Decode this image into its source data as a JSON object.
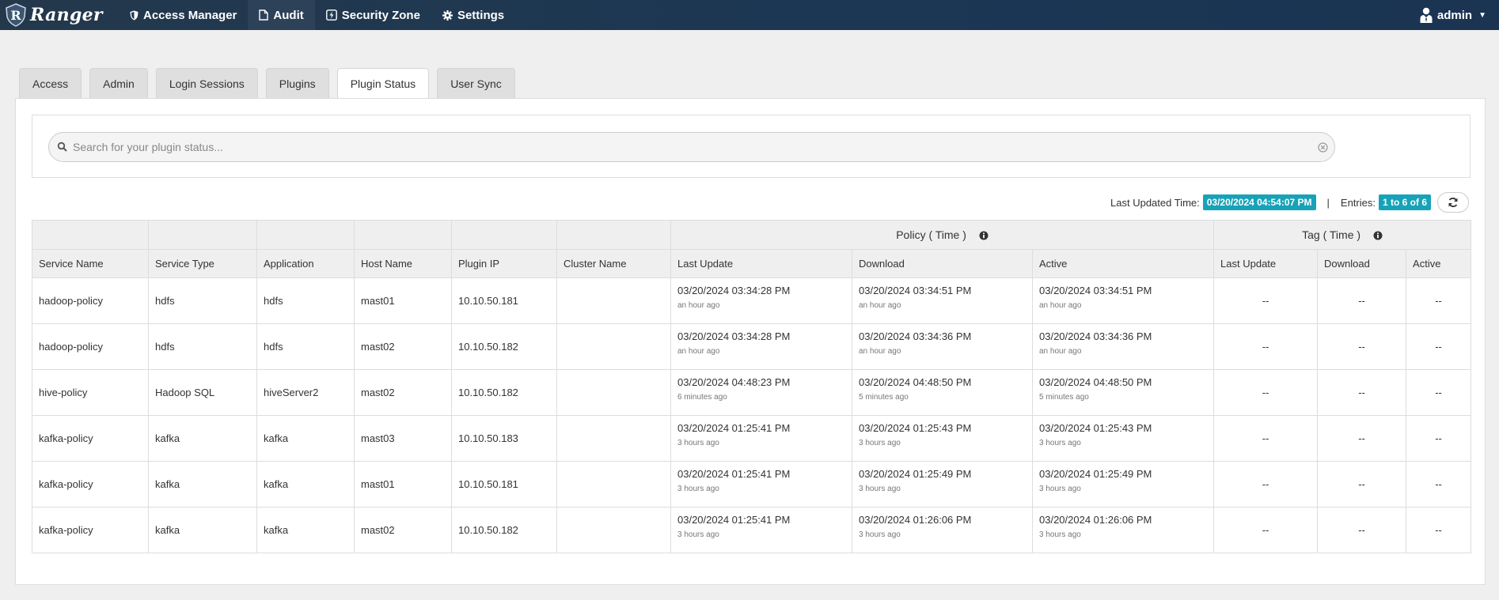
{
  "navbar": {
    "brand": "Ranger",
    "items": [
      {
        "label": "Access Manager",
        "icon": "shield-icon"
      },
      {
        "label": "Audit",
        "icon": "file-icon"
      },
      {
        "label": "Security Zone",
        "icon": "bolt-square-icon"
      },
      {
        "label": "Settings",
        "icon": "gear-icon"
      }
    ],
    "active": "Audit",
    "user": "admin"
  },
  "tabs": [
    "Access",
    "Admin",
    "Login Sessions",
    "Plugins",
    "Plugin Status",
    "User Sync"
  ],
  "active_tab": "Plugin Status",
  "search": {
    "placeholder": "Search for your plugin status..."
  },
  "status": {
    "last_updated_label": "Last Updated Time:",
    "last_updated_value": "03/20/2024 04:54:07 PM",
    "separator": "|",
    "entries_label": "Entries:",
    "entries_value": "1 to 6 of 6"
  },
  "table": {
    "groups": {
      "policy": "Policy ( Time )",
      "tag": "Tag ( Time )"
    },
    "columns": [
      "Service Name",
      "Service Type",
      "Application",
      "Host Name",
      "Plugin IP",
      "Cluster Name",
      "Last Update",
      "Download",
      "Active",
      "Last Update",
      "Download",
      "Active"
    ],
    "rows": [
      {
        "service": "hadoop-policy",
        "type": "hdfs",
        "app": "hdfs",
        "host": "mast01",
        "ip": "10.10.50.181",
        "cluster": "",
        "p_last": "03/20/2024 03:34:28 PM",
        "p_last_ago": "an hour ago",
        "p_dl": "03/20/2024 03:34:51 PM",
        "p_dl_ago": "an hour ago",
        "p_act": "03/20/2024 03:34:51 PM",
        "p_act_ago": "an hour ago",
        "t_last": "--",
        "t_dl": "--",
        "t_act": "--"
      },
      {
        "service": "hadoop-policy",
        "type": "hdfs",
        "app": "hdfs",
        "host": "mast02",
        "ip": "10.10.50.182",
        "cluster": "",
        "p_last": "03/20/2024 03:34:28 PM",
        "p_last_ago": "an hour ago",
        "p_dl": "03/20/2024 03:34:36 PM",
        "p_dl_ago": "an hour ago",
        "p_act": "03/20/2024 03:34:36 PM",
        "p_act_ago": "an hour ago",
        "t_last": "--",
        "t_dl": "--",
        "t_act": "--"
      },
      {
        "service": "hive-policy",
        "type": "Hadoop SQL",
        "app": "hiveServer2",
        "host": "mast02",
        "ip": "10.10.50.182",
        "cluster": "",
        "p_last": "03/20/2024 04:48:23 PM",
        "p_last_ago": "6 minutes ago",
        "p_dl": "03/20/2024 04:48:50 PM",
        "p_dl_ago": "5 minutes ago",
        "p_act": "03/20/2024 04:48:50 PM",
        "p_act_ago": "5 minutes ago",
        "t_last": "--",
        "t_dl": "--",
        "t_act": "--"
      },
      {
        "service": "kafka-policy",
        "type": "kafka",
        "app": "kafka",
        "host": "mast03",
        "ip": "10.10.50.183",
        "cluster": "",
        "p_last": "03/20/2024 01:25:41 PM",
        "p_last_ago": "3 hours ago",
        "p_dl": "03/20/2024 01:25:43 PM",
        "p_dl_ago": "3 hours ago",
        "p_act": "03/20/2024 01:25:43 PM",
        "p_act_ago": "3 hours ago",
        "t_last": "--",
        "t_dl": "--",
        "t_act": "--"
      },
      {
        "service": "kafka-policy",
        "type": "kafka",
        "app": "kafka",
        "host": "mast01",
        "ip": "10.10.50.181",
        "cluster": "",
        "p_last": "03/20/2024 01:25:41 PM",
        "p_last_ago": "3 hours ago",
        "p_dl": "03/20/2024 01:25:49 PM",
        "p_dl_ago": "3 hours ago",
        "p_act": "03/20/2024 01:25:49 PM",
        "p_act_ago": "3 hours ago",
        "t_last": "--",
        "t_dl": "--",
        "t_act": "--"
      },
      {
        "service": "kafka-policy",
        "type": "kafka",
        "app": "kafka",
        "host": "mast02",
        "ip": "10.10.50.182",
        "cluster": "",
        "p_last": "03/20/2024 01:25:41 PM",
        "p_last_ago": "3 hours ago",
        "p_dl": "03/20/2024 01:26:06 PM",
        "p_dl_ago": "3 hours ago",
        "p_act": "03/20/2024 01:26:06 PM",
        "p_act_ago": "3 hours ago",
        "t_last": "--",
        "t_dl": "--",
        "t_act": "--"
      }
    ]
  },
  "colors": {
    "navbar": "#1b3754",
    "badge": "#17a2b8",
    "header_bg": "#efefef"
  }
}
